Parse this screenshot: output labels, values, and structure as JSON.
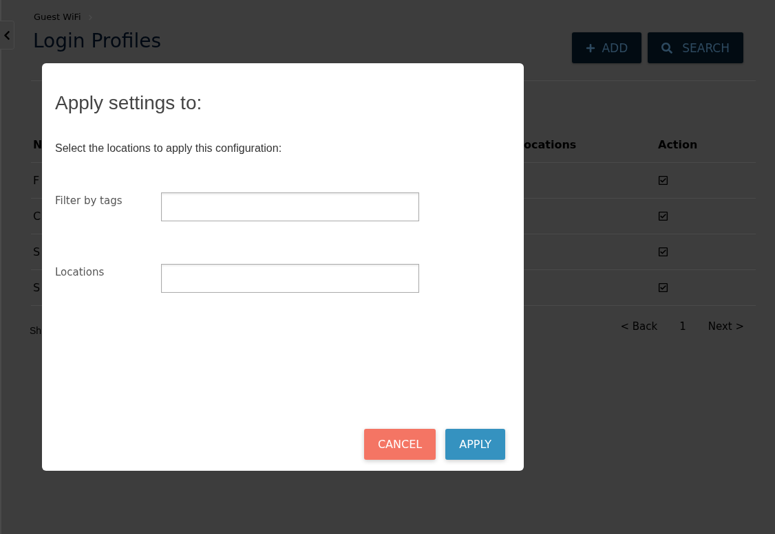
{
  "breadcrumb": [
    {
      "label": "Guest WiFi"
    }
  ],
  "page_title": "Login Profiles",
  "header_buttons": [
    {
      "kind": "add",
      "label": "ADD"
    },
    {
      "kind": "search",
      "label": "SEARCH"
    }
  ],
  "table": {
    "columns": [
      {
        "label": "N"
      },
      {
        "label": "ocations"
      },
      {
        "label": "Action"
      }
    ],
    "rows": [
      {
        "column_1": "F"
      },
      {
        "column_1": "C"
      },
      {
        "column_1": "S"
      },
      {
        "column_1": "S"
      }
    ]
  },
  "summary": "Sh",
  "pagination": {
    "back": "< Back",
    "pages": [
      "1"
    ],
    "next": "Next >"
  },
  "dialog": {
    "title": "Apply settings to:",
    "instruction": "Select the locations to apply this configuration:",
    "fields": [
      {
        "label": "Filter by tags"
      },
      {
        "label": "Locations"
      }
    ],
    "buttons": [
      {
        "kind": "cancel",
        "label": "CANCEL"
      },
      {
        "kind": "apply",
        "label": "APPLY"
      }
    ]
  }
}
